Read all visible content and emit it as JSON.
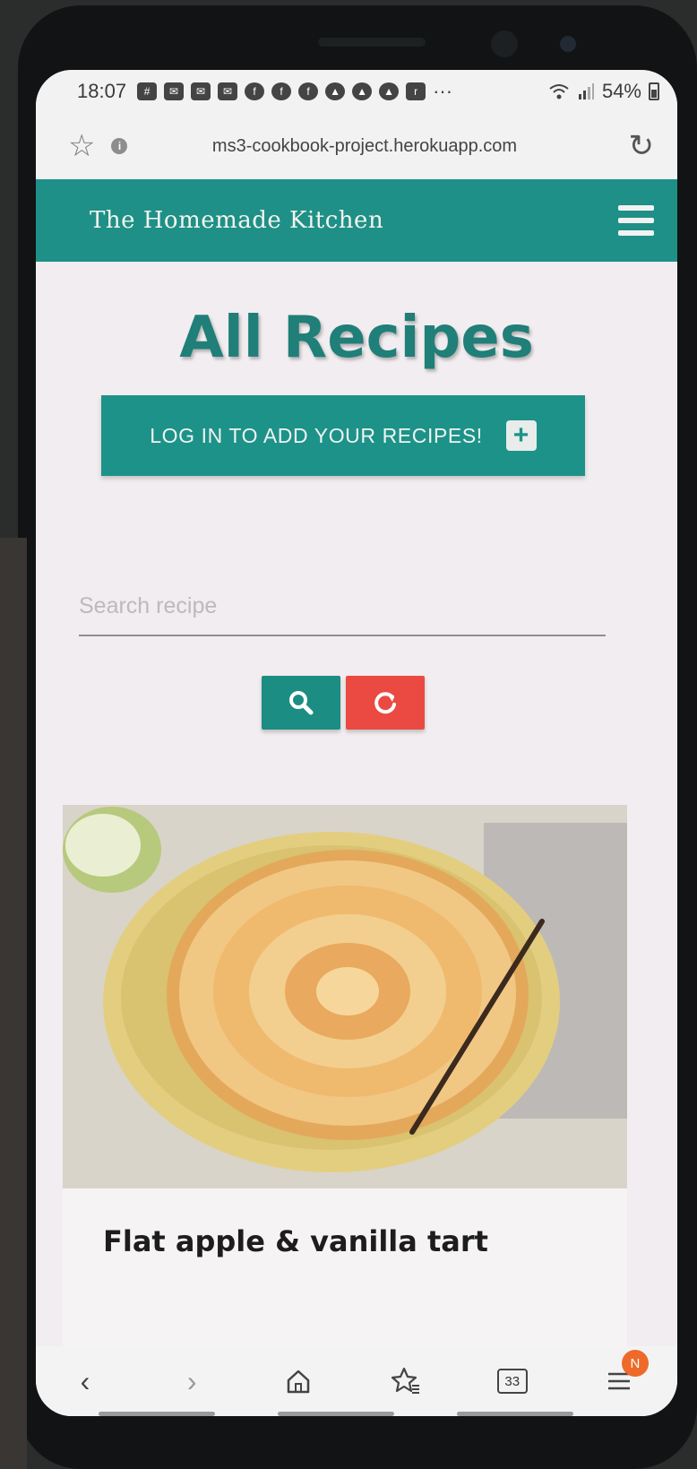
{
  "status_bar": {
    "time": "18:07",
    "battery": "54%",
    "notification_icons": [
      "slack-icon",
      "mail-icon",
      "mail-icon",
      "mail-icon",
      "facebook-icon",
      "facebook-icon",
      "facebook-icon",
      "snapchat-icon",
      "snapchat-icon",
      "snapchat-icon",
      "ring-icon"
    ],
    "overflow": "···"
  },
  "browser": {
    "url": "ms3-cookbook-project.herokuapp.com"
  },
  "header": {
    "brand": "The Homemade Kitchen"
  },
  "main": {
    "title": "All Recipes",
    "login_cta": "LOG IN TO ADD YOUR RECIPES!",
    "search": {
      "placeholder": "Search recipe",
      "value": ""
    }
  },
  "recipes": [
    {
      "title": "Flat apple & vanilla tart"
    }
  ],
  "bottom_nav": {
    "tabs_count": "33",
    "menu_badge": "N"
  },
  "colors": {
    "brand_teal": "#1e9087",
    "reset_red": "#ea4a42",
    "badge_orange": "#ee6a2a"
  }
}
